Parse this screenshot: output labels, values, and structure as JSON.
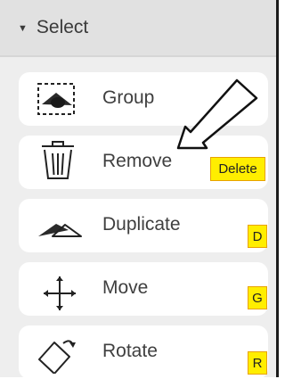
{
  "section": {
    "title": "Select",
    "caret_icon": "triangle-down-icon"
  },
  "tools": [
    {
      "label": "Group",
      "icon": "group-icon",
      "shortcut": ""
    },
    {
      "label": "Remove",
      "icon": "trash-icon",
      "shortcut": "Delete"
    },
    {
      "label": "Duplicate",
      "icon": "duplicate-icon",
      "shortcut": "D"
    },
    {
      "label": "Move",
      "icon": "move-arrows-icon",
      "shortcut": "G"
    },
    {
      "label": "Rotate",
      "icon": "rotate-icon",
      "shortcut": "R"
    }
  ],
  "annotation": {
    "icon": "hand-drawn-pointer-arrow-icon"
  },
  "colors": {
    "panel_bg": "#eeeeee",
    "header_bg": "#e1e1e1",
    "card_bg": "#ffffff",
    "shortcut_bg": "#ffee00",
    "shortcut_border": "#e8a200",
    "text": "#3f3f3f"
  }
}
